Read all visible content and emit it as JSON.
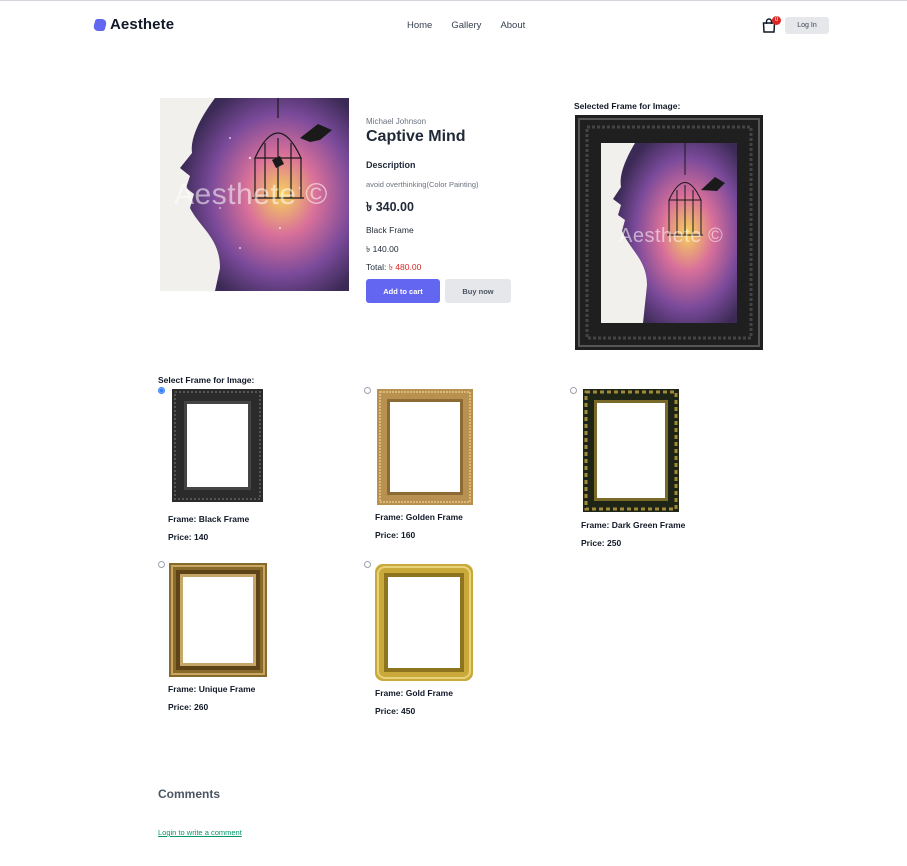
{
  "header": {
    "brand": "Aesthete",
    "nav": [
      "Home",
      "Gallery",
      "About"
    ],
    "cart_count": "0",
    "login_label": "Log In"
  },
  "product": {
    "watermark": "Aesthete ©",
    "artist": "Michael Johnson",
    "title": "Captive Mind",
    "description_heading": "Description",
    "description": "avoid overthinking(Color Painting)",
    "price": "৳ 340.00",
    "frame_name": "Black Frame",
    "frame_price": "৳ 140.00",
    "total_label": "Total:",
    "total_value": "৳ 480.00",
    "add_to_cart": "Add to cart",
    "buy_now": "Buy now"
  },
  "selected_frame": {
    "label": "Selected Frame for Image:",
    "watermark": "Aesthete ©"
  },
  "frames": {
    "label": "Select Frame for Image:",
    "items": [
      {
        "name": "Frame: Black Frame",
        "price": "Price: 140",
        "checked": true,
        "color": "#2b2b2b"
      },
      {
        "name": "Frame: Golden Frame",
        "price": "Price: 160",
        "checked": false,
        "color": "#b8904f"
      },
      {
        "name": "Frame: Dark Green Frame",
        "price": "Price: 250",
        "checked": false,
        "color": "#2f3a22"
      },
      {
        "name": "Frame: Unique Frame",
        "price": "Price: 260",
        "checked": false,
        "color": "#8a6a2a"
      },
      {
        "name": "Frame: Gold Frame",
        "price": "Price: 450",
        "checked": false,
        "color": "#c9a93a"
      }
    ]
  },
  "comments": {
    "heading": "Comments",
    "login_link": "Login to write a comment"
  }
}
